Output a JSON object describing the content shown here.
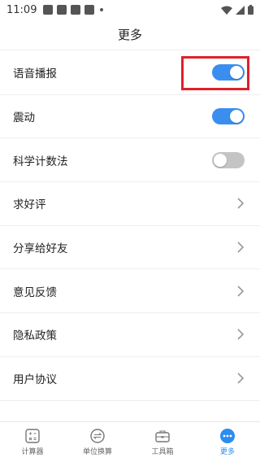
{
  "status": {
    "time": "11:09"
  },
  "header": {
    "title": "更多"
  },
  "rows": [
    {
      "label": "语音播报",
      "type": "toggle",
      "on": true
    },
    {
      "label": "震动",
      "type": "toggle",
      "on": true
    },
    {
      "label": "科学计数法",
      "type": "toggle",
      "on": false
    },
    {
      "label": "求好评",
      "type": "link"
    },
    {
      "label": "分享给好友",
      "type": "link"
    },
    {
      "label": "意见反馈",
      "type": "link"
    },
    {
      "label": "隐私政策",
      "type": "link"
    },
    {
      "label": "用户协议",
      "type": "link"
    }
  ],
  "tabs": [
    {
      "label": "计算器",
      "icon": "calculator-icon",
      "active": false
    },
    {
      "label": "单位换算",
      "icon": "exchange-icon",
      "active": false
    },
    {
      "label": "工具箱",
      "icon": "toolbox-icon",
      "active": false
    },
    {
      "label": "更多",
      "icon": "more-icon",
      "active": true
    }
  ],
  "colors": {
    "accent": "#2d8cf0",
    "toggle_on": "#3a8ef0",
    "toggle_off": "#c4c4c4",
    "highlight": "#e0202b"
  }
}
